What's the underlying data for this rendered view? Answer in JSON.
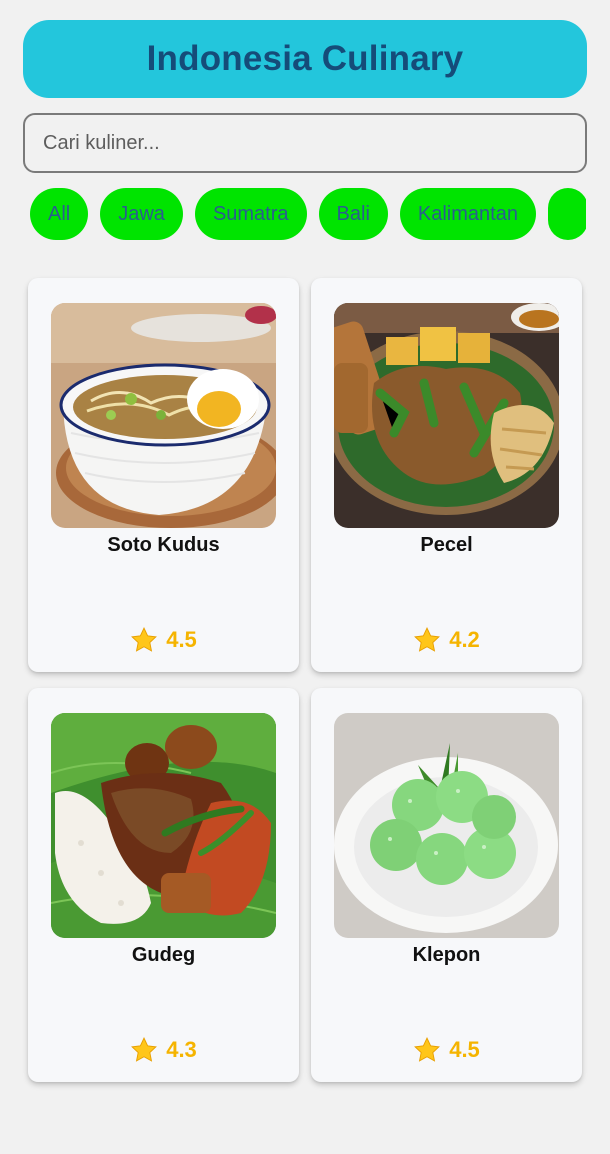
{
  "header": {
    "title": "Indonesia Culinary"
  },
  "search": {
    "placeholder": "Cari kuliner..."
  },
  "filters": [
    "All",
    "Jawa",
    "Sumatra",
    "Bali",
    "Kalimantan",
    ""
  ],
  "foods": [
    {
      "name": "Soto Kudus",
      "rating": "4.5"
    },
    {
      "name": "Pecel",
      "rating": "4.2"
    },
    {
      "name": "Gudeg",
      "rating": "4.3"
    },
    {
      "name": "Klepon",
      "rating": "4.5"
    }
  ],
  "colors": {
    "header_bg": "#23c6dc",
    "header_text": "#154c79",
    "chip_bg": "#00e400",
    "chip_text": "#2a5d8f",
    "rating": "#f5b400"
  },
  "icons": {
    "rating": "star-icon"
  }
}
